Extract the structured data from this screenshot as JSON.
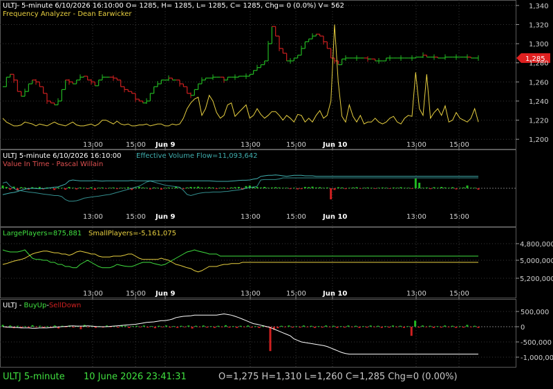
{
  "colors": {
    "up": "#22b822",
    "down": "#d02020",
    "yellow": "#e8d040",
    "cyan": "#40b0b0",
    "white": "#ffffff",
    "green": "#40e040",
    "grid": "#3a3a3a"
  },
  "panel1": {
    "title": "ULTJ- 5-minute 6/10/2026 16:10:00 O= 1285, H= 1285, L= 1285, C= 1285, Chg= 0 (0.0%) V= 562",
    "subtitle": "Frequency Analyzer - Dean Earwicker"
  },
  "panel2": {
    "title_a": "ULTJ 5-minute  6/10/2026 16:10:00",
    "title_b": "Effective Volume Flow=11,093,642",
    "subtitle": "Value In Time - Pascal Willain"
  },
  "panel3": {
    "title_a": "LargePlayers=875,881",
    "title_b": "SmallPlayers=-5,161,075"
  },
  "panel4": {
    "title_a": "ULTJ - ",
    "title_b": "BuyUp",
    "title_c": "-",
    "title_d": "SellDown"
  },
  "time_axis": {
    "labels": [
      "13:00",
      "15:00",
      "Jun 9",
      "13:00",
      "15:00",
      "Jun 10",
      "13:00",
      "15:00"
    ],
    "bold": [
      false,
      false,
      true,
      false,
      false,
      true,
      false,
      false
    ]
  },
  "status": {
    "symbol": "ULTJ  5-minute",
    "datetime": "10 June 2026 23:41:31",
    "ohlc": "O=1,275  H=1,310  L=1,260  C=1,285  Chg=0 (0.00%)"
  },
  "chart_data": [
    {
      "type": "line",
      "name": "price",
      "ylim": [
        1190,
        1345
      ],
      "yticks": [
        "1,200",
        "1,220",
        "1,240",
        "1,260",
        "1,280",
        "1,300",
        "1,320",
        "1,340"
      ],
      "last_price": "1,285",
      "price": [
        1255,
        1265,
        1268,
        1262,
        1250,
        1245,
        1250,
        1258,
        1262,
        1260,
        1255,
        1248,
        1240,
        1238,
        1236,
        1240,
        1252,
        1262,
        1260,
        1258,
        1262,
        1265,
        1266,
        1262,
        1260,
        1256,
        1262,
        1265,
        1265,
        1265,
        1264,
        1262,
        1255,
        1252,
        1250,
        1248,
        1242,
        1240,
        1238,
        1240,
        1248,
        1255,
        1258,
        1262,
        1262,
        1264,
        1262,
        1262,
        1258,
        1255,
        1248,
        1246,
        1252,
        1258,
        1262,
        1264,
        1264,
        1265,
        1265,
        1265,
        1262,
        1265,
        1265,
        1265,
        1266,
        1266,
        1266,
        1268,
        1272,
        1275,
        1278,
        1282,
        1300,
        1318,
        1308,
        1295,
        1290,
        1282,
        1282,
        1285,
        1288,
        1295,
        1302,
        1305,
        1308,
        1310,
        1308,
        1302,
        1295,
        1285,
        1282,
        1278,
        1284,
        1285,
        1285,
        1285,
        1285,
        1285,
        1285,
        1284,
        1284,
        1282,
        1282,
        1282,
        1285,
        1285,
        1285,
        1285,
        1285,
        1285,
        1285,
        1285,
        1286,
        1286,
        1288,
        1286,
        1286,
        1286,
        1285,
        1285,
        1286,
        1286,
        1286,
        1286,
        1286,
        1286,
        1286,
        1285,
        1285,
        1285
      ],
      "frequency": [
        1222,
        1218,
        1216,
        1214,
        1214,
        1215,
        1218,
        1217,
        1216,
        1214,
        1216,
        1215,
        1214,
        1216,
        1218,
        1216,
        1215,
        1214,
        1216,
        1218,
        1215,
        1214,
        1214,
        1215,
        1216,
        1214,
        1216,
        1220,
        1220,
        1218,
        1216,
        1219,
        1216,
        1215,
        1216,
        1214,
        1214,
        1215,
        1215,
        1216,
        1214,
        1215,
        1216,
        1216,
        1214,
        1214,
        1216,
        1215,
        1216,
        1222,
        1232,
        1238,
        1242,
        1244,
        1225,
        1232,
        1246,
        1240,
        1228,
        1222,
        1225,
        1236,
        1238,
        1224,
        1228,
        1232,
        1236,
        1222,
        1225,
        1232,
        1226,
        1222,
        1225,
        1229,
        1229,
        1225,
        1220,
        1225,
        1222,
        1218,
        1226,
        1225,
        1218,
        1222,
        1218,
        1225,
        1230,
        1222,
        1225,
        1240,
        1320,
        1260,
        1224,
        1218,
        1236,
        1224,
        1218,
        1225,
        1216,
        1218,
        1218,
        1222,
        1218,
        1216,
        1218,
        1222,
        1224,
        1218,
        1216,
        1222,
        1225,
        1224,
        1270,
        1232,
        1225,
        1268,
        1222,
        1228,
        1232,
        1225,
        1235,
        1218,
        1220,
        1228,
        1222,
        1220,
        1218,
        1222,
        1232,
        1218
      ]
    },
    {
      "type": "line",
      "name": "evf",
      "ylim": [
        0,
        1
      ],
      "cyan": [
        0.22,
        0.25,
        0.28,
        0.3,
        0.33,
        0.38,
        0.42,
        0.44,
        0.45,
        0.44,
        0.43,
        0.44,
        0.45,
        0.47,
        0.49,
        0.5,
        0.55,
        0.6,
        0.72,
        0.75,
        0.73,
        0.72,
        0.72,
        0.72,
        0.72,
        0.73,
        0.72,
        0.71,
        0.72,
        0.72,
        0.72,
        0.72,
        0.72,
        0.72,
        0.72,
        0.73,
        0.72,
        0.72,
        0.72,
        0.72,
        0.72,
        0.72,
        0.72,
        0.72,
        0.72,
        0.72,
        0.72,
        0.72,
        0.72,
        0.72,
        0.72,
        0.72,
        0.72,
        0.72,
        0.72,
        0.72,
        0.72,
        0.71,
        0.7,
        0.7,
        0.7,
        0.7,
        0.71,
        0.72,
        0.73,
        0.74,
        0.74,
        0.75,
        0.78,
        0.8,
        0.88,
        0.9,
        0.92,
        0.92,
        0.93,
        0.92,
        0.9,
        0.88,
        0.9,
        0.92,
        0.92,
        0.92,
        0.9,
        0.9,
        0.9,
        0.88,
        0.88,
        0.88,
        0.88,
        0.88,
        0.88,
        0.88,
        0.88,
        0.88,
        0.88,
        0.88,
        0.88,
        0.88,
        0.88,
        0.88,
        0.88,
        0.88,
        0.88,
        0.88,
        0.88,
        0.88,
        0.88,
        0.88,
        0.88,
        0.88,
        0.88,
        0.88,
        0.88,
        0.88,
        0.88,
        0.88,
        0.88,
        0.88,
        0.88,
        0.88,
        0.88,
        0.88,
        0.88,
        0.88,
        0.88,
        0.88,
        0.88,
        0.88,
        0.88,
        0.88
      ],
      "histogram": [
        0.1,
        0.05,
        -0.05,
        0.06,
        -0.08,
        0.04,
        0.03,
        -0.05,
        0.04,
        0.02,
        0.05,
        -0.04,
        0.03,
        0.02,
        -0.06,
        0.03,
        0.02,
        -0.05,
        0.05,
        0.02,
        -0.04,
        0.03,
        0.02,
        -0.03,
        0.04,
        -0.05,
        0.02,
        0.03,
        -0.02,
        0.02,
        0.03,
        -0.03,
        0.02,
        0.02,
        0.04,
        -0.06,
        0.02,
        0.05,
        0.03,
        0.02,
        -0.04,
        0.03,
        0.02,
        -0.05,
        0.02,
        0.03,
        0.02,
        0.05,
        0.02,
        -0.03,
        0.03,
        0.05,
        0.04,
        0.06,
        0.03,
        0.02,
        0.04,
        0.03,
        -0.03,
        0.02,
        0.03,
        -0.02,
        0.03,
        0.04,
        0.05,
        -0.05,
        0.08,
        0.1,
        0.06,
        0.05,
        0.03,
        0.05,
        0.02,
        0.03,
        0.04,
        0.03,
        0.02,
        0.02,
        -0.03,
        0.02,
        -0.04,
        -0.03,
        0.05,
        0.04,
        0.06,
        0.03,
        0.04,
        0.02,
        0.03,
        -0.4,
        -0.06,
        0.04,
        0.03,
        -0.03,
        0.02,
        0.03,
        0.04,
        -0.02,
        0.02,
        0.03,
        0.02,
        -0.02,
        0.02,
        0.03,
        0.02,
        -0.02,
        0.03,
        0.02,
        0.04,
        0.02,
        0.02,
        -0.02,
        0.35,
        0.2,
        0.02,
        0.03,
        -0.03,
        0.04,
        0.02,
        0.05,
        0.03,
        0.02,
        0.04,
        -0.04,
        0.02,
        0.03,
        0.1,
        0.02,
        0.02,
        -0.05
      ],
      "green_line": [
        0.25,
        0.3,
        0.1,
        0.0,
        -0.1,
        -0.12,
        -0.15,
        -0.18,
        -0.2,
        -0.22,
        -0.25,
        -0.28,
        -0.3,
        -0.32,
        -0.35,
        -0.35,
        -0.4,
        -0.55,
        -0.62,
        -0.62,
        -0.6,
        -0.55,
        -0.48,
        -0.45,
        -0.42,
        -0.4,
        -0.38,
        -0.35,
        -0.32,
        -0.3,
        -0.25,
        -0.2,
        -0.15,
        -0.1,
        -0.05,
        0.0,
        0.05,
        0.1,
        0.2,
        0.3,
        0.35,
        0.3,
        0.25,
        0.2,
        0.15,
        0.12,
        0.1,
        0.08,
        0.05,
        -0.1,
        -0.3,
        -0.35,
        -0.3,
        -0.25,
        -0.22,
        -0.2,
        -0.2,
        -0.18,
        -0.18,
        -0.18,
        -0.16,
        -0.15,
        -0.12,
        -0.1,
        -0.08,
        -0.05,
        0.0,
        0.05,
        0.05,
        0.1,
        0.4,
        0.42,
        0.42,
        0.42,
        0.42,
        0.45,
        0.5,
        0.5,
        0.5,
        0.5,
        0.5,
        0.5,
        0.5,
        0.5,
        0.5,
        0.5,
        0.5,
        0.5,
        0.5,
        0.5,
        0.5,
        0.5,
        0.5,
        0.5,
        0.5,
        0.5,
        0.5,
        0.5,
        0.5,
        0.5,
        0.5,
        0.5,
        0.5,
        0.5,
        0.5,
        0.5,
        0.5,
        0.5,
        0.5,
        0.5,
        0.5,
        0.5,
        0.5,
        0.5,
        0.5,
        0.5,
        0.5,
        0.5,
        0.5,
        0.5,
        0.5,
        0.5,
        0.5,
        0.5,
        0.5,
        0.5,
        0.5,
        0.5,
        0.5,
        0.5
      ]
    },
    {
      "type": "line",
      "name": "players",
      "yticks": [
        "4,800,000",
        "5,000,000",
        "5,200,000"
      ],
      "large": [
        0.65,
        0.62,
        0.6,
        0.6,
        0.6,
        0.62,
        0.65,
        0.55,
        0.45,
        0.42,
        0.42,
        0.4,
        0.4,
        0.35,
        0.35,
        0.3,
        0.3,
        0.25,
        0.25,
        0.22,
        0.22,
        0.3,
        0.35,
        0.4,
        0.35,
        0.3,
        0.25,
        0.22,
        0.22,
        0.22,
        0.25,
        0.3,
        0.28,
        0.26,
        0.25,
        0.25,
        0.28,
        0.32,
        0.35,
        0.35,
        0.35,
        0.32,
        0.3,
        0.28,
        0.3,
        0.35,
        0.4,
        0.45,
        0.5,
        0.55,
        0.6,
        0.62,
        0.65,
        0.62,
        0.6,
        0.58,
        0.55,
        0.55,
        0.55,
        0.5,
        0.5,
        0.5,
        0.5,
        0.5,
        0.5,
        0.5,
        0.5,
        0.5,
        0.5,
        0.5,
        0.5,
        0.5,
        0.5,
        0.5,
        0.5,
        0.5,
        0.5,
        0.5,
        0.5,
        0.5,
        0.5,
        0.5,
        0.5,
        0.5,
        0.5,
        0.5,
        0.5,
        0.5,
        0.5,
        0.5,
        0.5,
        0.5,
        0.5,
        0.5,
        0.5,
        0.5,
        0.5,
        0.5,
        0.5,
        0.5,
        0.5,
        0.5,
        0.5,
        0.5,
        0.5,
        0.5,
        0.5,
        0.5,
        0.5,
        0.5,
        0.5,
        0.5,
        0.5,
        0.5,
        0.5,
        0.5,
        0.5,
        0.5,
        0.5,
        0.5,
        0.5,
        0.5,
        0.5,
        0.5,
        0.5,
        0.5,
        0.5,
        0.5,
        0.5,
        0.5
      ],
      "small": [
        0.3,
        0.32,
        0.35,
        0.38,
        0.4,
        0.42,
        0.45,
        0.5,
        0.55,
        0.58,
        0.6,
        0.62,
        0.62,
        0.6,
        0.58,
        0.58,
        0.55,
        0.55,
        0.52,
        0.55,
        0.6,
        0.62,
        0.6,
        0.58,
        0.55,
        0.55,
        0.5,
        0.48,
        0.48,
        0.48,
        0.5,
        0.5,
        0.5,
        0.52,
        0.55,
        0.55,
        0.5,
        0.45,
        0.42,
        0.42,
        0.42,
        0.42,
        0.42,
        0.45,
        0.42,
        0.4,
        0.35,
        0.3,
        0.28,
        0.25,
        0.22,
        0.2,
        0.15,
        0.12,
        0.15,
        0.2,
        0.25,
        0.25,
        0.25,
        0.28,
        0.3,
        0.3,
        0.32,
        0.32,
        0.32,
        0.35,
        0.35,
        0.35,
        0.35,
        0.35,
        0.35,
        0.35,
        0.35,
        0.35,
        0.35,
        0.35,
        0.35,
        0.35,
        0.35,
        0.35,
        0.35,
        0.35,
        0.35,
        0.35,
        0.35,
        0.35,
        0.35,
        0.35,
        0.35,
        0.35,
        0.35,
        0.35,
        0.35,
        0.35,
        0.35,
        0.35,
        0.35,
        0.35,
        0.35,
        0.35,
        0.35,
        0.35,
        0.35,
        0.35,
        0.35,
        0.35,
        0.35,
        0.35,
        0.35,
        0.35,
        0.35,
        0.35,
        0.35,
        0.35,
        0.35,
        0.35,
        0.35,
        0.35,
        0.35,
        0.35,
        0.35,
        0.35,
        0.35,
        0.35,
        0.35,
        0.35,
        0.35,
        0.35,
        0.35,
        0.35
      ]
    },
    {
      "type": "line",
      "name": "buyup-selldown",
      "yticks": [
        "500,000",
        "0",
        "-500,000",
        "-1,000,000"
      ],
      "ylim": [
        -1200000,
        800000
      ],
      "line": [
        0,
        -10000,
        -20000,
        -20000,
        -30000,
        -40000,
        -40000,
        -40000,
        -50000,
        -50000,
        -40000,
        -40000,
        -40000,
        -30000,
        -20000,
        -10000,
        0,
        10000,
        20000,
        30000,
        20000,
        20000,
        20000,
        30000,
        20000,
        10000,
        0,
        0,
        0,
        10000,
        20000,
        30000,
        40000,
        50000,
        60000,
        70000,
        80000,
        100000,
        120000,
        140000,
        150000,
        160000,
        180000,
        200000,
        200000,
        220000,
        250000,
        300000,
        320000,
        340000,
        350000,
        360000,
        380000,
        380000,
        380000,
        380000,
        380000,
        380000,
        380000,
        400000,
        420000,
        400000,
        380000,
        340000,
        300000,
        250000,
        200000,
        150000,
        100000,
        80000,
        50000,
        20000,
        -10000,
        -50000,
        -100000,
        -150000,
        -200000,
        -250000,
        -300000,
        -400000,
        -450000,
        -500000,
        -520000,
        -540000,
        -560000,
        -580000,
        -600000,
        -620000,
        -650000,
        -700000,
        -750000,
        -800000,
        -850000,
        -880000,
        -900000,
        -900000,
        -900000,
        -900000,
        -900000,
        -900000,
        -900000,
        -900000,
        -900000,
        -900000,
        -900000,
        -900000,
        -900000,
        -900000,
        -900000,
        -900000,
        -900000,
        -900000,
        -900000,
        -900000,
        -900000,
        -900000,
        -900000,
        -900000,
        -900000,
        -900000,
        -900000,
        -900000,
        -900000,
        -900000,
        -900000,
        -900000,
        -900000,
        -900000,
        -900000,
        -900000
      ],
      "histogram": [
        60000,
        -30000,
        40000,
        -50000,
        30000,
        -40000,
        20000,
        -30000,
        50000,
        -20000,
        30000,
        -40000,
        20000,
        -30000,
        40000,
        -60000,
        30000,
        -20000,
        40000,
        -30000,
        20000,
        -80000,
        60000,
        -20000,
        30000,
        -40000,
        20000,
        -30000,
        40000,
        -20000,
        20000,
        -30000,
        40000,
        30000,
        -40000,
        20000,
        30000,
        -20000,
        40000,
        -30000,
        20000,
        -50000,
        30000,
        -20000,
        40000,
        -30000,
        20000,
        -40000,
        30000,
        -20000,
        40000,
        -60000,
        30000,
        -20000,
        40000,
        -30000,
        20000,
        -40000,
        30000,
        -20000,
        50000,
        -30000,
        20000,
        -40000,
        30000,
        -20000,
        40000,
        -30000,
        20000,
        -40000,
        30000,
        -20000,
        -800000,
        -100000,
        -50000,
        30000,
        -20000,
        40000,
        -30000,
        20000,
        -30000,
        40000,
        -20000,
        30000,
        -40000,
        20000,
        -30000,
        40000,
        -20000,
        30000,
        -40000,
        20000,
        -30000,
        40000,
        -20000,
        30000,
        -40000,
        20000,
        -30000,
        40000,
        -20000,
        30000,
        -40000,
        20000,
        -30000,
        40000,
        -20000,
        30000,
        -40000,
        20000,
        -300000,
        200000,
        -30000,
        40000,
        -20000,
        30000,
        -40000,
        20000,
        -30000,
        40000,
        -20000,
        30000,
        -40000,
        20000,
        -30000,
        60000,
        -20000,
        30000,
        -40000
      ]
    }
  ]
}
